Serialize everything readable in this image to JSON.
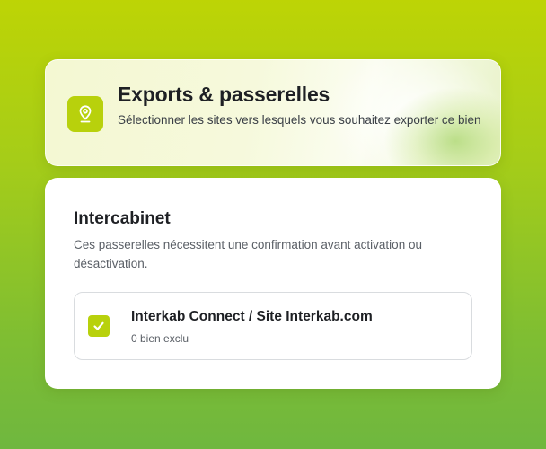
{
  "header": {
    "title": "Exports & passerelles",
    "subtitle": "Sélectionner les sites vers lesquels vous souhaitez exporter ce bien",
    "icon": "map-pin-icon"
  },
  "section": {
    "title": "Intercabinet",
    "description": "Ces passerelles nécessitent une confirmation avant activation ou désactivation."
  },
  "sites": [
    {
      "name": "Interkab Connect / Site Interkab.com",
      "meta": "0 bien exclu",
      "checked": true
    }
  ],
  "colors": {
    "accent": "#b8d10c",
    "text_primary": "#1e2024",
    "text_secondary": "#5a5f66",
    "border": "#d9dcdf"
  }
}
